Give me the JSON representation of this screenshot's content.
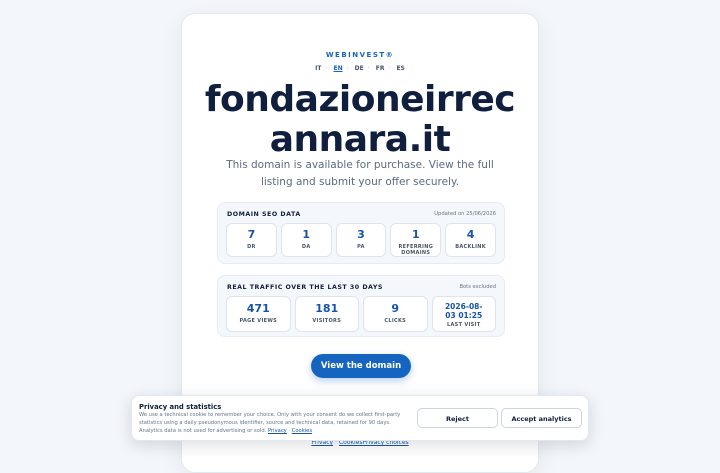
{
  "brand": "WEBINVEST®",
  "languages": [
    {
      "code": "IT",
      "active": false
    },
    {
      "code": "EN",
      "active": true
    },
    {
      "code": "DE",
      "active": false
    },
    {
      "code": "FR",
      "active": false
    },
    {
      "code": "ES",
      "active": false
    }
  ],
  "domain": {
    "line1": "fondazioneirrec",
    "line2": "annara.it"
  },
  "description": "This domain is available for purchase. View the full listing and submit your offer securely.",
  "seo": {
    "title": "DOMAIN SEO DATA",
    "note": "Updated on 25/06/2026",
    "stats": [
      {
        "value": "7",
        "label": "DR"
      },
      {
        "value": "1",
        "label": "DA"
      },
      {
        "value": "3",
        "label": "PA"
      },
      {
        "value": "1",
        "label": "REFERRING DOMAINS"
      },
      {
        "value": "4",
        "label": "BACKLINK"
      }
    ]
  },
  "traffic": {
    "title": "REAL TRAFFIC OVER THE LAST 30 DAYS",
    "note": "Bots excluded",
    "stats": [
      {
        "value": "471",
        "label": "PAGE VIEWS"
      },
      {
        "value": "181",
        "label": "VISITORS"
      },
      {
        "value": "9",
        "label": "CLICKS"
      },
      {
        "value": "2026-08-03 01:25",
        "label": "LAST VISIT"
      }
    ]
  },
  "cta_label": "View the domain",
  "cookie": {
    "title": "Privacy and statistics",
    "text": "We use a technical cookie to remember your choice. Only with your consent do we collect first-party statistics using a daily pseudonymous identifier, source and technical data, retained for 90 days. Analytics data is not used for advertising or sold.",
    "privacy_link": "Privacy",
    "cookies_link": "Cookies",
    "reject_label": "Reject",
    "accept_label": "Accept analytics"
  },
  "footer": {
    "privacy": "Privacy",
    "cookies": "Cookies",
    "privacy_choices": "Privacy choices"
  }
}
